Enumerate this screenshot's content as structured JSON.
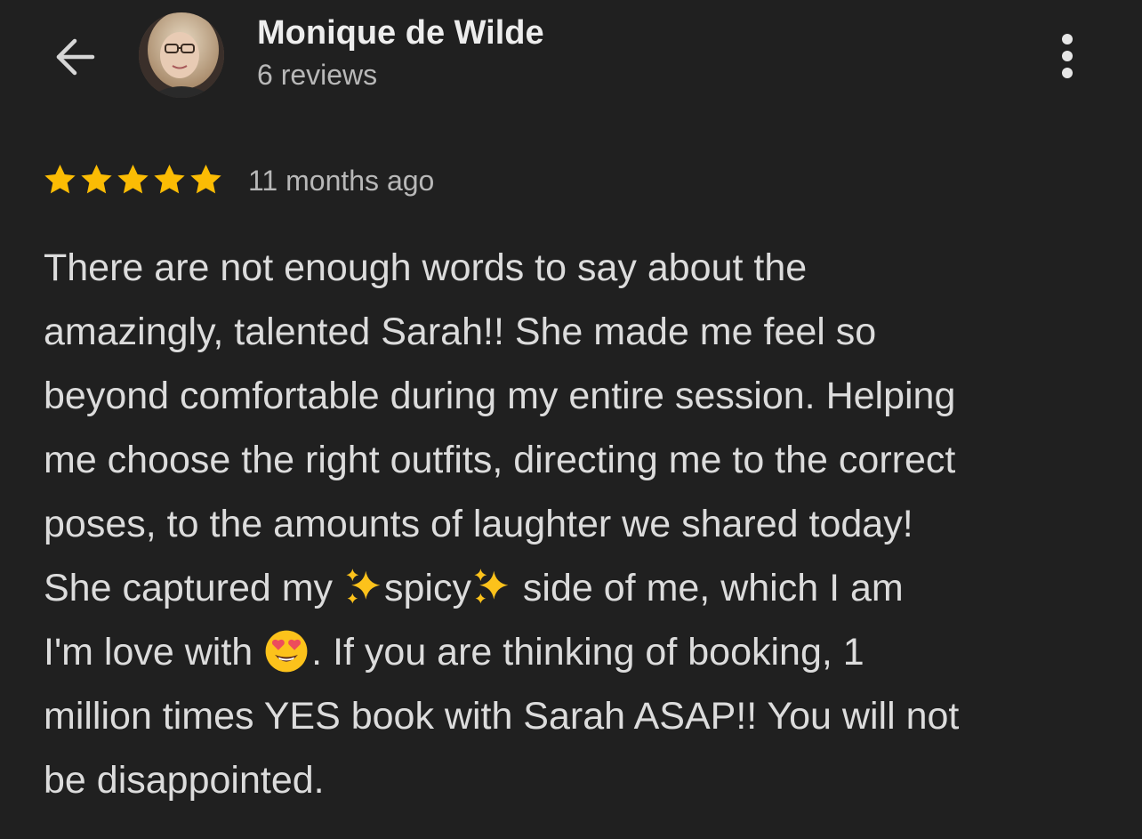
{
  "header": {
    "user_name": "Monique de Wilde",
    "review_count": "6 reviews"
  },
  "review": {
    "rating": 5,
    "rating_max": 5,
    "timestamp": "11 months ago",
    "lines": {
      "l1": "There are not enough words to say about the",
      "l2": "amazingly, talented Sarah!! She made me feel so",
      "l3": "beyond comfortable during my entire session. Helping",
      "l4": "me choose the right outfits, directing me to the correct",
      "l5": "poses, to the amounts of laughter we shared today!",
      "l6a": "She captured my ",
      "l6b": "spicy",
      "l6c": " side of me, which I am",
      "l7a": "I'm love with ",
      "l7b": ". If you are thinking of booking, 1",
      "l8": "million times YES book with Sarah ASAP!! You will not",
      "l9": "be disappointed."
    }
  },
  "icons": {
    "back": "arrow-left-icon",
    "more": "more-vertical-icon",
    "star": "star-icon",
    "sparkles": "sparkles-emoji",
    "heart_eyes": "smiling-face-with-heart-eyes-emoji"
  },
  "colors": {
    "background": "#202020",
    "star": "#fbbc04",
    "primary_text": "#ededed",
    "secondary_text": "#b8b8b8"
  }
}
